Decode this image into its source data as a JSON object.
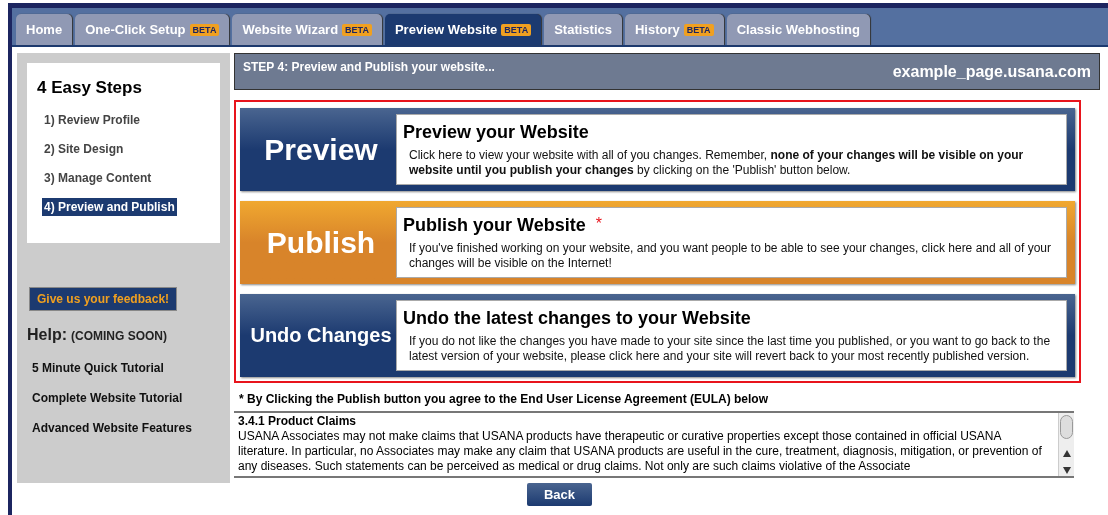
{
  "tabs": [
    {
      "label": "Home",
      "selected": false
    },
    {
      "label": "One-Click Setup",
      "badge": "BETA",
      "selected": false
    },
    {
      "label": "Website Wizard",
      "badge": "BETA",
      "selected": false
    },
    {
      "label": "Preview Website",
      "badge": "BETA",
      "selected": true
    },
    {
      "label": "Statistics",
      "selected": false
    },
    {
      "label": "History",
      "badge": "BETA",
      "selected": false
    },
    {
      "label": "Classic Webhosting",
      "selected": false
    }
  ],
  "sidebar": {
    "steps_title": "4 Easy Steps",
    "steps": [
      {
        "label": "1) Review Profile",
        "selected": false
      },
      {
        "label": "2) Site Design",
        "selected": false
      },
      {
        "label": "3) Manage Content",
        "selected": false
      },
      {
        "label": "4) Preview and Publish",
        "selected": true
      }
    ],
    "feedback_button": "Give us your feedback!",
    "help_title": "Help:",
    "help_note": "(COMING SOON)",
    "help_links": [
      "5 Minute Quick Tutorial",
      "Complete Website Tutorial",
      "Advanced Website Features"
    ]
  },
  "header": {
    "step": "STEP 4: Preview and Publish your website...",
    "domain": "example_page.usana.com"
  },
  "actions": [
    {
      "kind": "preview",
      "label": "Preview",
      "title": "Preview your Website",
      "description": "Click here to view your website with all of you changes.  Remember, **none of your changes will be visible on your website until you publish your changes** by clicking on the 'Publish' button below."
    },
    {
      "kind": "publish",
      "label": "Publish",
      "title": "Publish your Website",
      "marker": "*",
      "description": "If you've finished working on your website, and you want people to be able to see your changes, click here and all of your changes will be visible on the Internet!"
    },
    {
      "kind": "undo",
      "label": "Undo Changes",
      "title": "Undo the latest changes to your Website",
      "description": "If you do not like the changes you have made to your site since the last time you published, or you want to go back to the latest version of your website, please click here and your site will revert back to your most recently published version."
    }
  ],
  "eula": {
    "notice": "* By Clicking the Publish button you agree to the End User License Agreement (EULA) below",
    "heading": "3.4.1 Product Claims",
    "text": "USANA Associates may not make claims that USANA products have therapeutic or curative properties except those contained in official USANA literature. In particular, no Associates may make any claim that USANA products are useful in the cure, treatment, diagnosis, mitigation, or prevention of any diseases. Such statements can be perceived as medical or drug claims. Not only are such claims violative of the Associate"
  },
  "back_button": "Back"
}
